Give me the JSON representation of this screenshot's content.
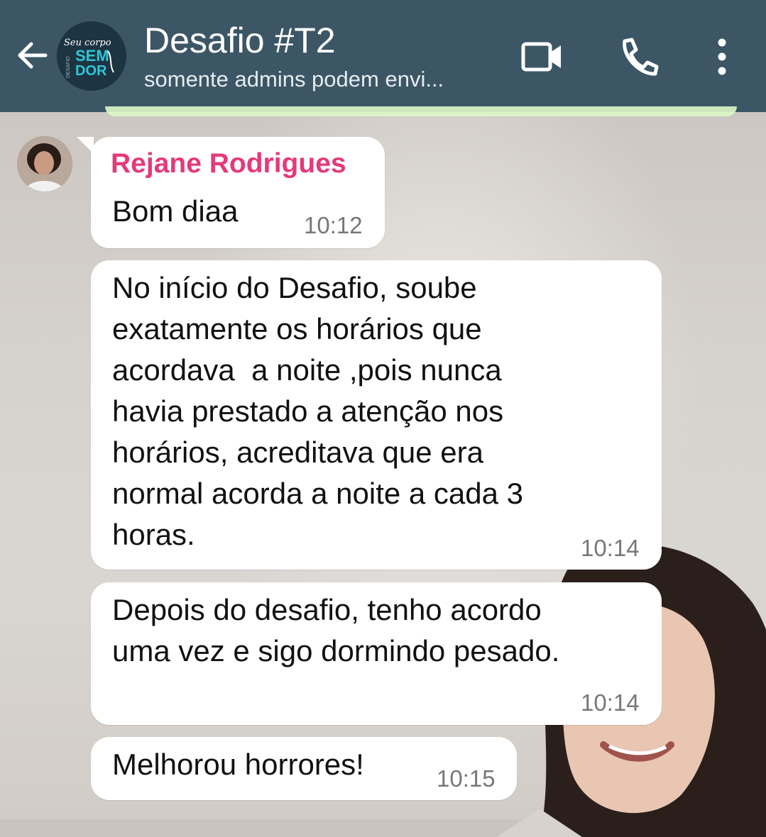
{
  "header": {
    "title": "Desafio #T2",
    "subtitle": "somente admins podem envi...",
    "group_logo": {
      "line1": "Seu corpo",
      "line2": "SEM",
      "line3": "DOR",
      "side": "DESAFIO"
    }
  },
  "messages": [
    {
      "sender": "Rejane Rodrigues",
      "text": "Bom diaa",
      "time": "10:12"
    },
    {
      "text": "No início do Desafio, soube\nexatamente os horários que\nacordava  a noite ,pois nunca\nhavia prestado a atenção nos\nhorários, acreditava que era\nnormal acorda a noite a cada 3\nhoras.",
      "time": "10:14"
    },
    {
      "text": "Depois do desafio, tenho acordo\numa vez e sigo dormindo pesado.",
      "time": "10:14"
    },
    {
      "text": "Melhorou horrores!",
      "time": "10:15"
    }
  ],
  "colors": {
    "header_bg": "#3c5665",
    "sender_name": "#e5397a",
    "bubble": "#ffffff",
    "timestamp": "#777777"
  },
  "icons": [
    "arrow-left-icon",
    "video-camera-icon",
    "phone-icon",
    "more-vertical-icon"
  ]
}
